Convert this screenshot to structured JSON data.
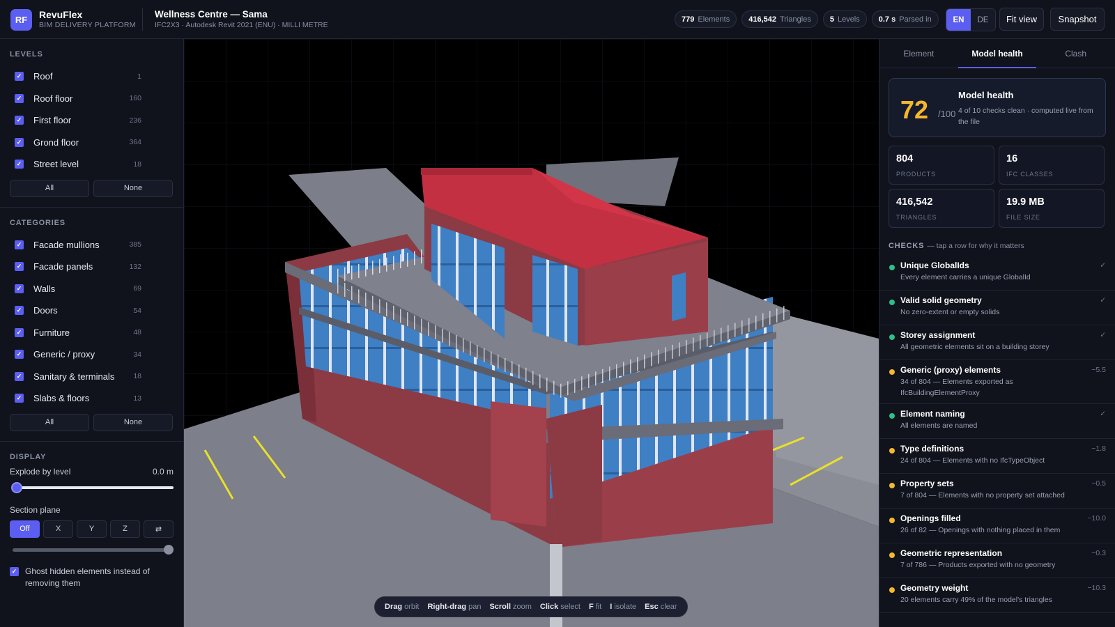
{
  "app": {
    "logo": "RF",
    "name": "RevuFlex",
    "tagline": "BIM DELIVERY PLATFORM"
  },
  "project": {
    "name": "Wellness Centre — Sama",
    "meta": "IFC2X3 · Autodesk Revit 2021 (ENU) · MILLI METRE"
  },
  "pills": [
    {
      "value": "779",
      "label": "Elements"
    },
    {
      "value": "416,542",
      "label": "Triangles"
    },
    {
      "value": "5",
      "label": "Levels"
    },
    {
      "value": "0.7 s",
      "label": "Parsed in"
    }
  ],
  "languages": {
    "en": "EN",
    "de": "DE",
    "active": "EN"
  },
  "toolbar": {
    "fit_view": "Fit view",
    "snapshot": "Snapshot"
  },
  "levels": {
    "title": "LEVELS",
    "items": [
      {
        "label": "Roof",
        "count": "1"
      },
      {
        "label": "Roof floor",
        "count": "160"
      },
      {
        "label": "First floor",
        "count": "236"
      },
      {
        "label": "Grond floor",
        "count": "364"
      },
      {
        "label": "Street level",
        "count": "18"
      }
    ],
    "all": "All",
    "none": "None"
  },
  "categories": {
    "title": "CATEGORIES",
    "items": [
      {
        "label": "Facade mullions",
        "count": "385"
      },
      {
        "label": "Facade panels",
        "count": "132"
      },
      {
        "label": "Walls",
        "count": "69"
      },
      {
        "label": "Doors",
        "count": "54"
      },
      {
        "label": "Furniture",
        "count": "48"
      },
      {
        "label": "Generic / proxy",
        "count": "34"
      },
      {
        "label": "Sanitary & terminals",
        "count": "18"
      },
      {
        "label": "Slabs & floors",
        "count": "13"
      }
    ],
    "all": "All",
    "none": "None"
  },
  "display": {
    "title": "DISPLAY",
    "explode_label": "Explode by level",
    "explode_value": "0.0 m",
    "section_label": "Section plane",
    "section_options": [
      "Off",
      "X",
      "Y",
      "Z",
      "⇄"
    ],
    "section_active": "Off",
    "ghost_label": "Ghost hidden elements instead of removing them"
  },
  "hints": [
    {
      "key": "Drag",
      "action": "orbit"
    },
    {
      "key": "Right-drag",
      "action": "pan"
    },
    {
      "key": "Scroll",
      "action": "zoom"
    },
    {
      "key": "Click",
      "action": "select"
    },
    {
      "key": "F",
      "action": "fit"
    },
    {
      "key": "I",
      "action": "isolate"
    },
    {
      "key": "Esc",
      "action": "clear"
    }
  ],
  "panel": {
    "tabs": [
      "Element",
      "Model health",
      "Clash"
    ],
    "active_tab": "Model health",
    "score": "72",
    "score_of": "/100",
    "health_title": "Model health",
    "health_desc": "4 of 10 checks clean · computed live from the file",
    "stats": [
      {
        "value": "804",
        "label": "PRODUCTS"
      },
      {
        "value": "16",
        "label": "IFC CLASSES"
      },
      {
        "value": "416,542",
        "label": "TRIANGLES"
      },
      {
        "value": "19.9 MB",
        "label": "FILE SIZE"
      }
    ],
    "checks_title": "CHECKS",
    "checks_hint": "— tap a row for why it matters",
    "checks": [
      {
        "title": "Unique GlobalIds",
        "desc": "Every element carries a unique GlobalId",
        "score": "✓",
        "status": "ok"
      },
      {
        "title": "Valid solid geometry",
        "desc": "No zero-extent or empty solids",
        "score": "✓",
        "status": "ok"
      },
      {
        "title": "Storey assignment",
        "desc": "All geometric elements sit on a building storey",
        "score": "✓",
        "status": "ok"
      },
      {
        "title": "Generic (proxy) elements",
        "desc": "34 of 804 — Elements exported as IfcBuildingElementProxy",
        "score": "−5.5",
        "status": "warn"
      },
      {
        "title": "Element naming",
        "desc": "All elements are named",
        "score": "✓",
        "status": "ok"
      },
      {
        "title": "Type definitions",
        "desc": "24 of 804 — Elements with no IfcTypeObject",
        "score": "−1.8",
        "status": "warn"
      },
      {
        "title": "Property sets",
        "desc": "7 of 804 — Elements with no property set attached",
        "score": "−0.5",
        "status": "warn"
      },
      {
        "title": "Openings filled",
        "desc": "26 of 82 — Openings with nothing placed in them",
        "score": "−10.0",
        "status": "warn"
      },
      {
        "title": "Geometric representation",
        "desc": "7 of 786 — Products exported with no geometry",
        "score": "−0.3",
        "status": "warn"
      },
      {
        "title": "Geometry weight",
        "desc": "20 elements carry 49% of the model's triangles",
        "score": "−10.3",
        "status": "warn"
      }
    ]
  },
  "colors": {
    "accent": "#5b5ef0",
    "ok": "#2fbf8a",
    "warn": "#f5b72e",
    "score": "#f5b72e"
  }
}
